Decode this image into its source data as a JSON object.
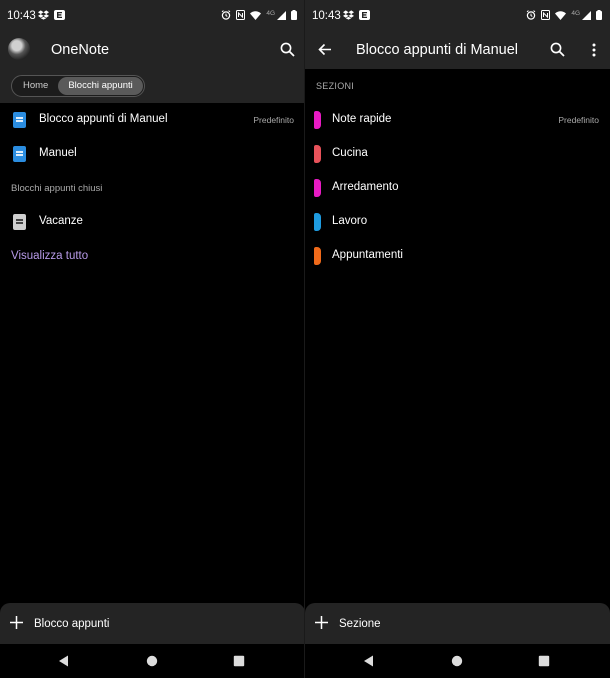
{
  "status_bar": {
    "time": "10:43",
    "network": "4G"
  },
  "left": {
    "title": "OneNote",
    "tabs": [
      {
        "label": "Home"
      },
      {
        "label": "Blocchi appunti",
        "active": true
      }
    ],
    "notebooks": [
      {
        "name": "Blocco appunti di Manuel",
        "tag": "Predefinito",
        "color": "#2b8de0"
      },
      {
        "name": "Manuel",
        "tag": "",
        "color": "#2b8de0"
      }
    ],
    "closed_header": "Blocchi appunti chiusi",
    "closed_notebooks": [
      {
        "name": "Vacanze",
        "color": "#cfcfcf"
      }
    ],
    "view_all": "Visualizza tutto",
    "add_label": "Blocco appunti"
  },
  "right": {
    "title": "Blocco appunti di Manuel",
    "sections_header": "SEZIONI",
    "sections": [
      {
        "name": "Note rapide",
        "tag": "Predefinito",
        "color": "#e81bc4"
      },
      {
        "name": "Cucina",
        "tag": "",
        "color": "#e8525a"
      },
      {
        "name": "Arredamento",
        "tag": "",
        "color": "#e81bc4"
      },
      {
        "name": "Lavoro",
        "tag": "",
        "color": "#1e9be0"
      },
      {
        "name": "Appuntamenti",
        "tag": "",
        "color": "#f06a1a"
      }
    ],
    "add_label": "Sezione"
  },
  "icons": {
    "search": "search-icon",
    "back": "arrow-back-icon",
    "more": "more-vert-icon",
    "add": "plus-icon",
    "nav_back": "nav-back-icon",
    "nav_home": "nav-home-icon",
    "nav_recents": "nav-recents-icon"
  }
}
